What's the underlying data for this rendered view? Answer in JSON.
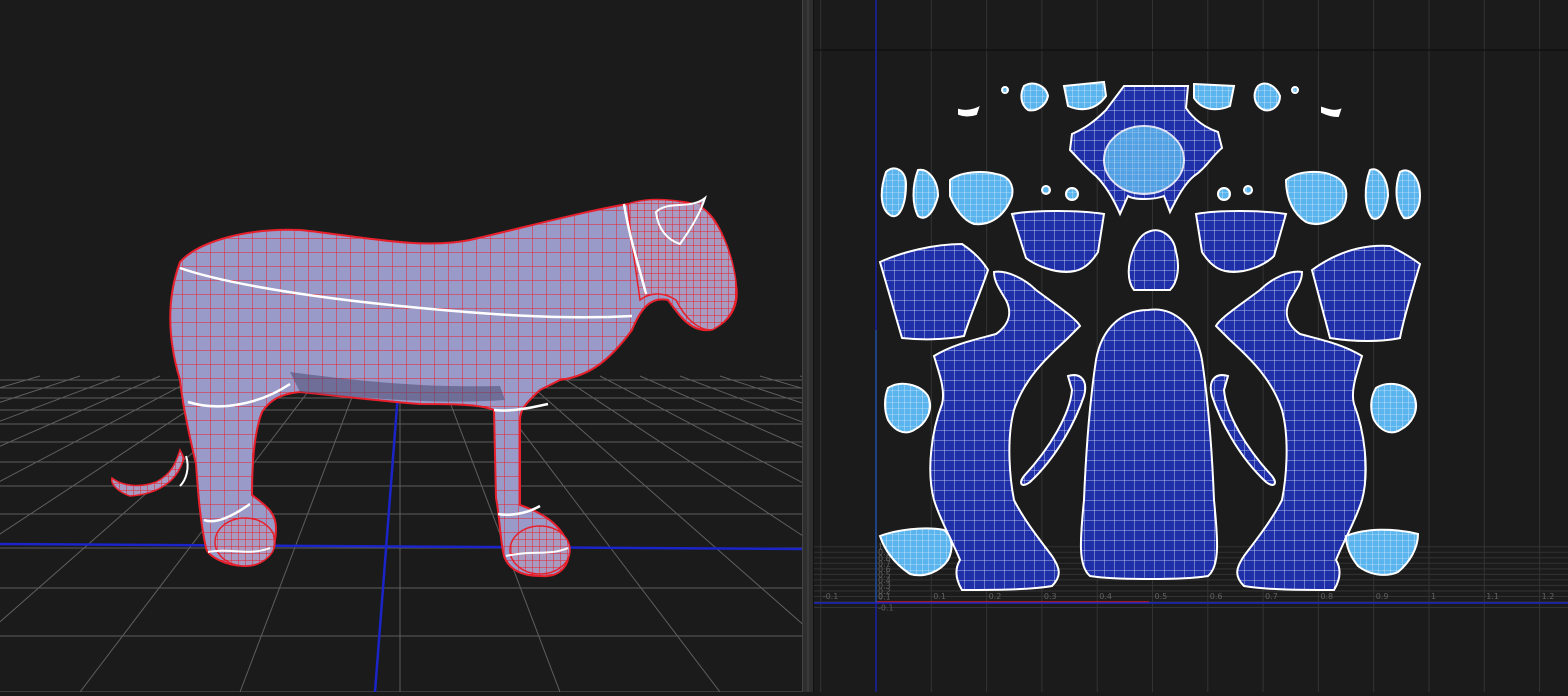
{
  "viewport_3d": {
    "mesh_name": "panther",
    "wire_color": "#e8202c",
    "surface_color": "#9a9ac8",
    "seam_color": "#ffffff",
    "grid_color": "#6a6a6a",
    "axis_color": "#1b24c8"
  },
  "uv_editor": {
    "x_ticks": [
      "-0.1",
      "0",
      "0.1",
      "0.2",
      "0.3",
      "0.4",
      "0.5",
      "0.6",
      "0.7",
      "0.8",
      "0.9",
      "1",
      "1.1",
      "1.2"
    ],
    "y_ticks": [
      "1",
      "0.9",
      "0.8",
      "0.7",
      "0.6",
      "0.5",
      "0.4",
      "0.3",
      "0.2",
      "0.1",
      "-0.1"
    ],
    "shell_fill": "#1f2fa8",
    "shell_light_fill": "#5ab4ee",
    "uv_wire": "#ffffff",
    "u_axis_color": "#c81e1e",
    "v_axis_color": "#1ec81e"
  }
}
